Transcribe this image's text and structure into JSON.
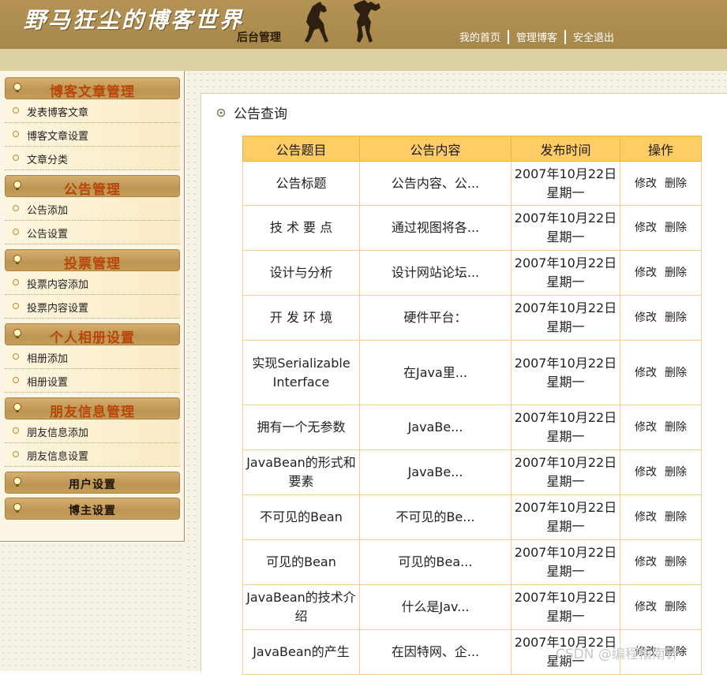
{
  "header": {
    "brand": "野马狂尘的博客世界",
    "subtitle": "后台管理",
    "nav": [
      {
        "label": "我的首页"
      },
      {
        "label": "管理博客"
      },
      {
        "label": "安全退出"
      }
    ]
  },
  "sidebar": {
    "groups": [
      {
        "title": "博客文章管理",
        "items": [
          {
            "label": "发表博客文章"
          },
          {
            "label": "博客文章设置"
          },
          {
            "label": "文章分类"
          }
        ]
      },
      {
        "title": "公告管理",
        "items": [
          {
            "label": "公告添加"
          },
          {
            "label": "公告设置"
          }
        ]
      },
      {
        "title": "投票管理",
        "items": [
          {
            "label": "投票内容添加"
          },
          {
            "label": "投票内容设置"
          }
        ]
      },
      {
        "title": "个人相册设置",
        "items": [
          {
            "label": "相册添加"
          },
          {
            "label": "相册设置"
          }
        ]
      },
      {
        "title": "朋友信息管理",
        "items": [
          {
            "label": "朋友信息添加"
          },
          {
            "label": "朋友信息设置"
          }
        ]
      },
      {
        "title": "用户设置",
        "items": []
      },
      {
        "title": "博主设置",
        "items": []
      }
    ]
  },
  "main": {
    "section_title": "公告查询",
    "columns": [
      "公告题目",
      "公告内容",
      "发布时间",
      "操作"
    ],
    "edit_label": "修改",
    "delete_label": "删除",
    "rows": [
      {
        "title": "公告标题",
        "content": "公告内容、公...",
        "date": "2007年10月22日 星期一"
      },
      {
        "title": "技 术 要 点",
        "content": "通过视图将各...",
        "date": "2007年10月22日 星期一"
      },
      {
        "title": "设计与分析",
        "content": "设计网站论坛...",
        "date": "2007年10月22日 星期一"
      },
      {
        "title": "开 发 环 境",
        "content": "硬件平台：",
        "date": "2007年10月22日 星期一"
      },
      {
        "title": "实现Serializable Interface",
        "content": "在Java里...",
        "date": "2007年10月22日 星期一"
      },
      {
        "title": "拥有一个无参数",
        "content": "JavaBe...",
        "date": "2007年10月22日 星期一"
      },
      {
        "title": "JavaBean的形式和要素",
        "content": "JavaBe...",
        "date": "2007年10月22日 星期一"
      },
      {
        "title": "不可见的Bean",
        "content": "不可见的Be...",
        "date": "2007年10月22日 星期一"
      },
      {
        "title": "可见的Bean",
        "content": "可见的Bea...",
        "date": "2007年10月22日 星期一"
      },
      {
        "title": "JavaBean的技术介绍",
        "content": "什么是Jav...",
        "date": "2007年10月22日 星期一"
      },
      {
        "title": "JavaBean的产生",
        "content": "在因特网、企...",
        "date": "2007年10月22日 星期一"
      }
    ]
  },
  "watermark": "CSDN @编程指南针",
  "colors": {
    "header_bg": "#a8874b",
    "table_header": "#ffcc66",
    "menu_title": "#b8460b"
  }
}
